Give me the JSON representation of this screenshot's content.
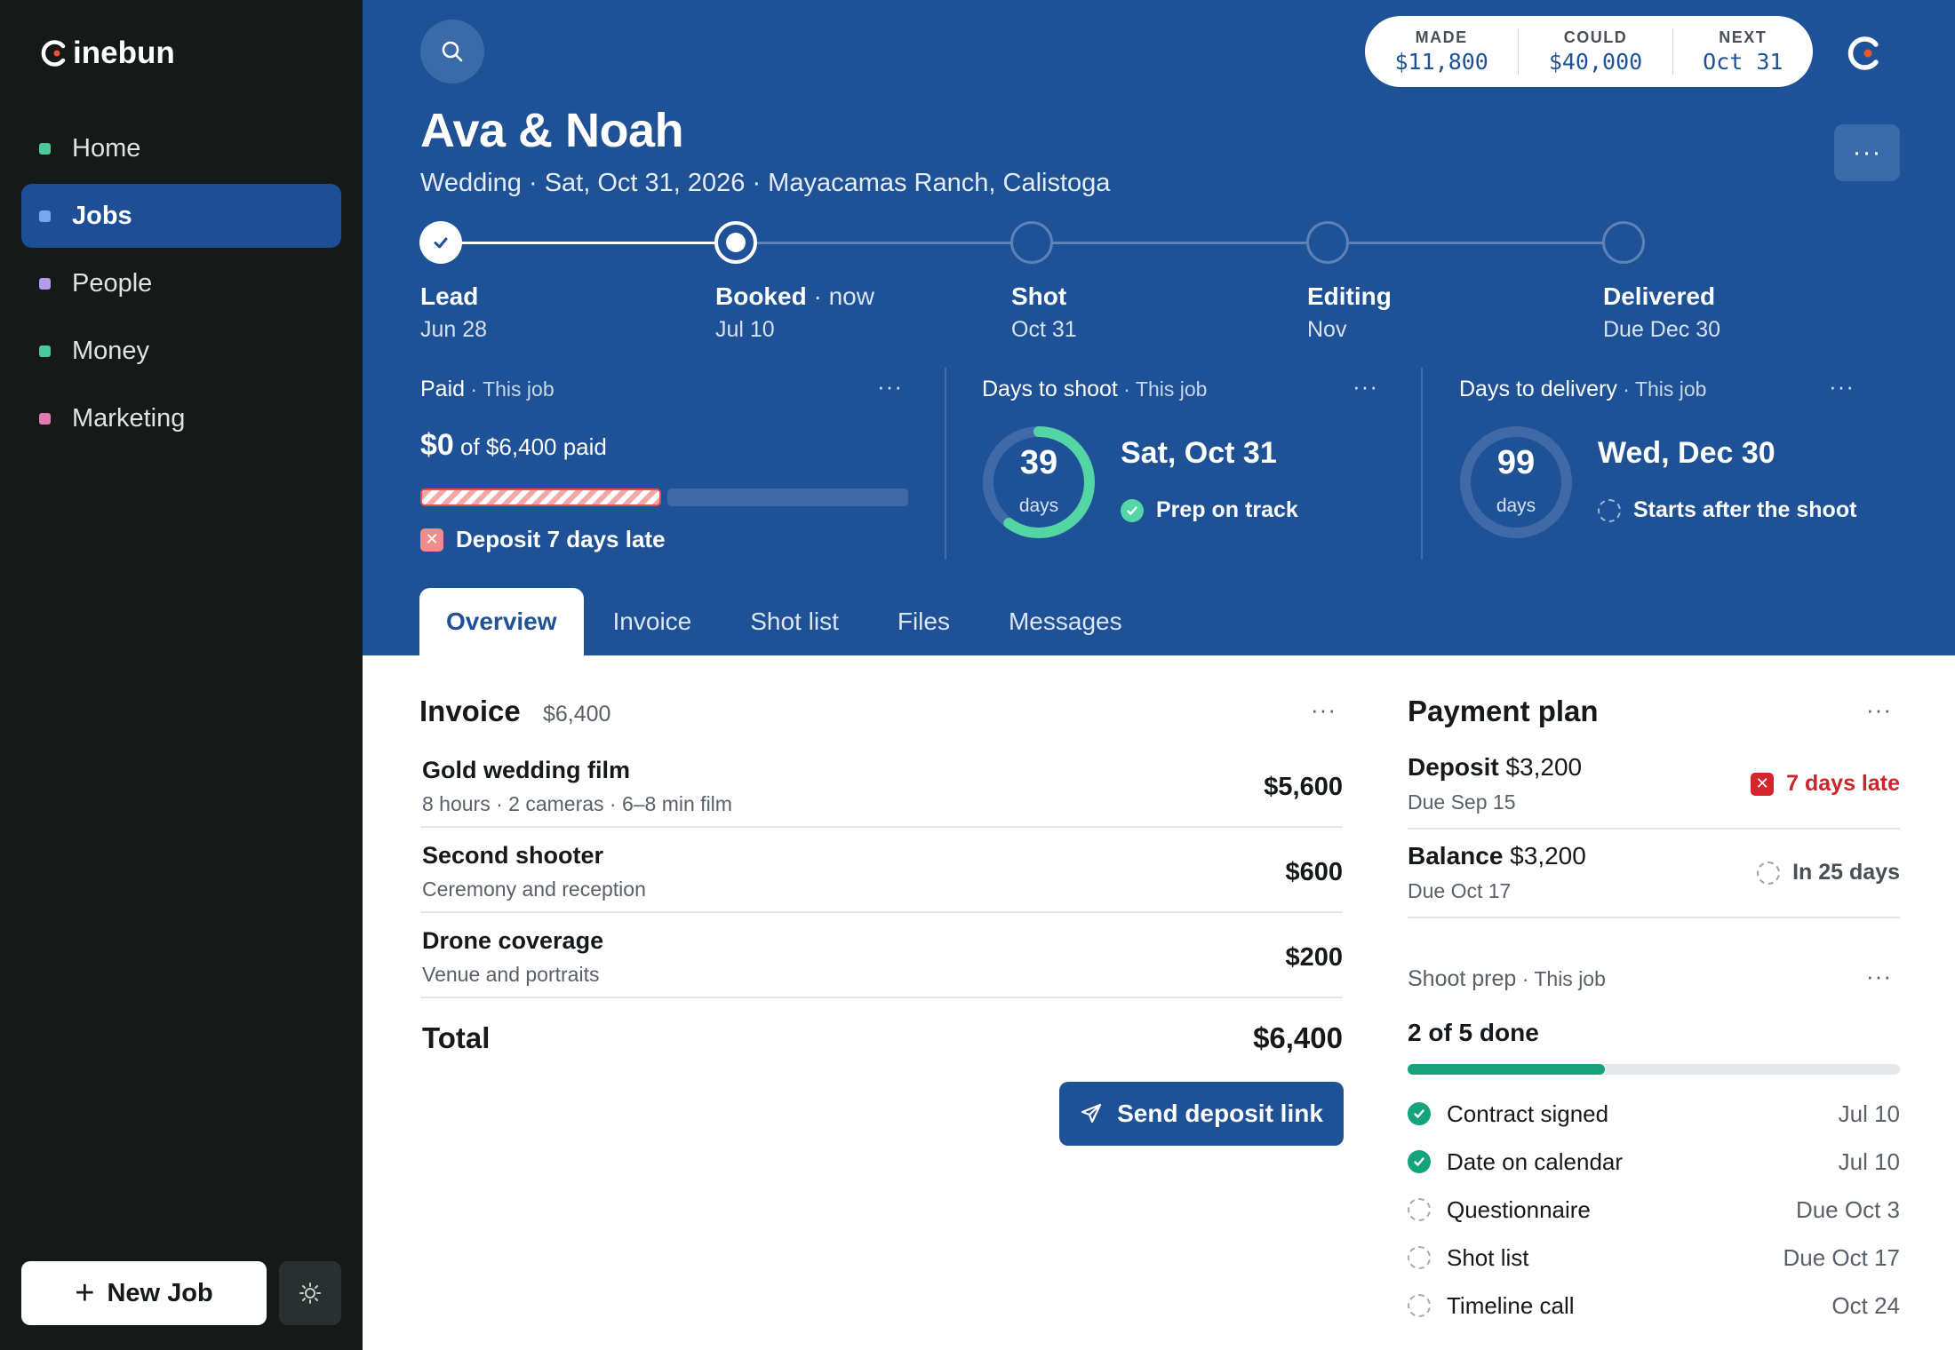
{
  "app": {
    "logo_text": "inebun"
  },
  "sidebar": {
    "items": [
      {
        "label": "Home",
        "color": "#4cc99a"
      },
      {
        "label": "Jobs",
        "color": "#7aa7ea"
      },
      {
        "label": "People",
        "color": "#b39ce8"
      },
      {
        "label": "Money",
        "color": "#4cc99a"
      },
      {
        "label": "Marketing",
        "color": "#e37bb3"
      }
    ],
    "active": "Jobs",
    "new_job_label": "New Job"
  },
  "stats": {
    "made_label": "MADE",
    "made_value": "$11,800",
    "could_label": "COULD",
    "could_value": "$40,000",
    "next_label": "NEXT",
    "next_value": "Oct 31"
  },
  "job": {
    "title": "Ava & Noah",
    "subtitle": "Wedding · Sat, Oct 31, 2026 · Mayacamas Ranch, Calistoga"
  },
  "steps": [
    {
      "label": "Lead",
      "aside": "",
      "date": "Jun 28",
      "state": "done"
    },
    {
      "label": "Booked",
      "aside": " · now",
      "date": "Jul 10",
      "state": "current"
    },
    {
      "label": "Shot",
      "aside": "",
      "date": "Oct 31",
      "state": "todo"
    },
    {
      "label": "Editing",
      "aside": "",
      "date": "Nov",
      "state": "todo"
    },
    {
      "label": "Delivered",
      "aside": "",
      "date": "Due Dec 30",
      "state": "todo"
    }
  ],
  "cards": {
    "paid": {
      "title": "Paid",
      "scope": "This job",
      "amount": "$0",
      "of_text": " of $6,400 paid",
      "status": "Deposit 7 days late"
    },
    "shoot": {
      "title": "Days to shoot",
      "scope": "This job",
      "days": "39",
      "unit": "days",
      "ring_fraction": 0.6,
      "date": "Sat, Oct 31",
      "status": "Prep on track"
    },
    "delivery": {
      "title": "Days to delivery",
      "scope": "This job",
      "days": "99",
      "unit": "days",
      "ring_fraction": 0,
      "date": "Wed, Dec 30",
      "status": "Starts after the shoot"
    }
  },
  "tabs": [
    "Overview",
    "Invoice",
    "Shot list",
    "Files",
    "Messages"
  ],
  "invoice": {
    "title": "Invoice",
    "amount": "$6,400",
    "items": [
      {
        "name": "Gold wedding film",
        "desc": "8 hours · 2 cameras · 6–8 min film",
        "price": "$5,600"
      },
      {
        "name": "Second shooter",
        "desc": "Ceremony and reception",
        "price": "$600"
      },
      {
        "name": "Drone coverage",
        "desc": "Venue and portraits",
        "price": "$200"
      }
    ],
    "total_label": "Total",
    "total_value": "$6,400",
    "send_label": "Send deposit link"
  },
  "payment_plan": {
    "title": "Payment plan",
    "rows": [
      {
        "name": "Deposit",
        "amount": " $3,200",
        "due": "Due Sep 15",
        "status": "7 days late",
        "kind": "late"
      },
      {
        "name": "Balance",
        "amount": " $3,200",
        "due": "Due Oct 17",
        "status": "In 25 days",
        "kind": "soon"
      }
    ]
  },
  "shoot_prep": {
    "title": "Shoot prep",
    "scope": "This job",
    "count": "2 of 5 done",
    "progress": 0.4,
    "tasks": [
      {
        "label": "Contract signed",
        "date": "Jul 10",
        "done": true
      },
      {
        "label": "Date on calendar",
        "date": "Jul 10",
        "done": true
      },
      {
        "label": "Questionnaire",
        "date": "Due Oct 3",
        "done": false
      },
      {
        "label": "Shot list",
        "date": "Due Oct 17",
        "done": false
      },
      {
        "label": "Timeline call",
        "date": "Oct 24",
        "done": false
      }
    ]
  }
}
